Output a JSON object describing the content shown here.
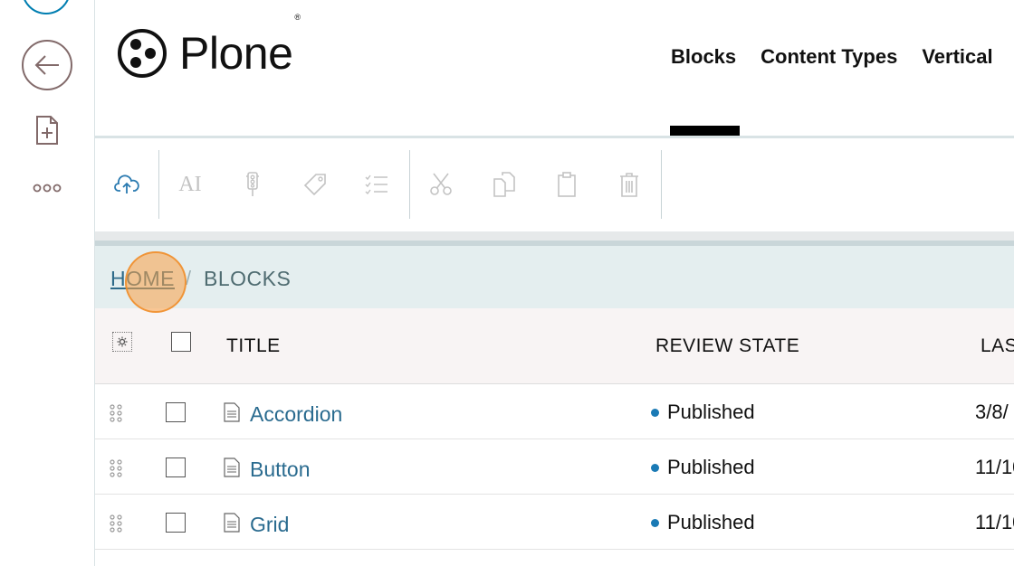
{
  "leftbar": {
    "icons": [
      "user-icon",
      "back-icon",
      "add-document-icon",
      "more-icon"
    ]
  },
  "header": {
    "logo_text": "Plone",
    "logo_reg": "®",
    "nav": [
      "Blocks",
      "Content Types",
      "Vertical"
    ]
  },
  "toolbar": {
    "icons": [
      "upload-icon",
      "ai-icon",
      "state-icon",
      "tag-icon",
      "checklist-icon",
      "cut-icon",
      "copy-icon",
      "paste-icon",
      "delete-icon"
    ],
    "ai_label": "AI"
  },
  "breadcrumbs": {
    "home": "HOME",
    "separator": "/",
    "current": "BLOCKS"
  },
  "table": {
    "columns": [
      "TITLE",
      "REVIEW STATE",
      "LAS"
    ],
    "rows": [
      {
        "title": "Accordion",
        "state": "Published",
        "modified": "3/8/"
      },
      {
        "title": "Button",
        "state": "Published",
        "modified": "11/10"
      },
      {
        "title": "Grid",
        "state": "Published",
        "modified": "11/10"
      }
    ]
  },
  "colors": {
    "link": "#2a6b8f",
    "state_published": "#1a7ab5",
    "breadcrumb_bg": "#e4eeef",
    "click_indicator": "#faa046"
  }
}
